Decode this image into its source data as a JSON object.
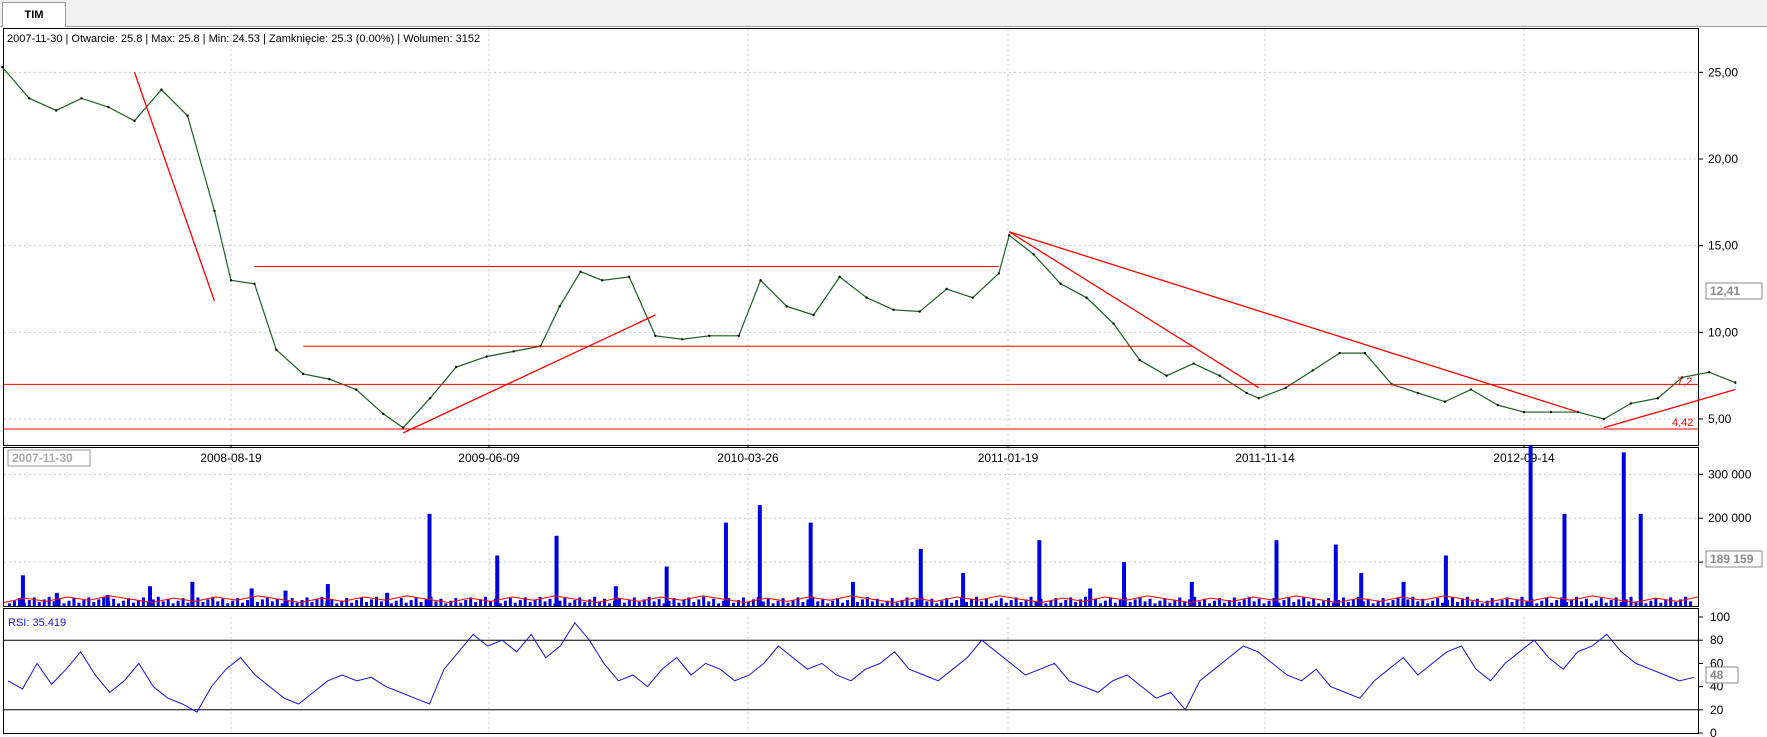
{
  "tab": {
    "label": "TIM"
  },
  "info_line": "2007-11-30 | Otwarcie: 25.8 | Max: 25.8 | Min: 24.53 | Zamknięcie: 25.3 (0.00%) | Wolumen: 3152",
  "cursor_date_label": "2007-11-30",
  "colors": {
    "price_line": "#1b5e20",
    "trend_lines": "#ff0000",
    "volume_bars": "#0000e0",
    "volume_avg": "#ff0000",
    "rsi_line": "#1515d6",
    "grid": "#c8c8c8"
  },
  "chart_data": [
    {
      "type": "line",
      "name": "price",
      "x_tick_labels": [
        "2008-08-19",
        "2009-06-09",
        "2010-03-26",
        "2011-01-19",
        "2011-11-14",
        "2012-09-14"
      ],
      "y_tick_labels": [
        "25,00",
        "20,00",
        "15,00",
        "10,00",
        "5,00"
      ],
      "ylim": [
        3.5,
        27.5
      ],
      "grid": true,
      "current_value_label": "12,41",
      "price_labels": [
        "7,2",
        "4,42"
      ],
      "x": [
        "2007-11-30",
        "2007-12-31",
        "2008-01-31",
        "2008-02-29",
        "2008-03-31",
        "2008-04-30",
        "2008-05-31",
        "2008-06-30",
        "2008-07-31",
        "2008-08-19",
        "2008-09-15",
        "2008-10-10",
        "2008-11-10",
        "2008-12-10",
        "2009-01-10",
        "2009-02-10",
        "2009-03-05",
        "2009-04-05",
        "2009-05-05",
        "2009-06-09",
        "2009-07-10",
        "2009-08-10",
        "2009-09-01",
        "2009-09-25",
        "2009-10-20",
        "2009-11-20",
        "2009-12-20",
        "2010-01-20",
        "2010-02-20",
        "2010-03-26",
        "2010-04-20",
        "2010-05-20",
        "2010-06-20",
        "2010-07-20",
        "2010-08-20",
        "2010-09-20",
        "2010-10-20",
        "2010-11-20",
        "2010-12-20",
        "2011-01-19",
        "2011-01-31",
        "2011-02-28",
        "2011-03-31",
        "2011-04-30",
        "2011-05-31",
        "2011-06-30",
        "2011-07-31",
        "2011-08-31",
        "2011-09-30",
        "2011-10-31",
        "2011-11-14",
        "2011-12-15",
        "2012-01-15",
        "2012-02-15",
        "2012-03-15",
        "2012-04-15",
        "2012-05-15",
        "2012-06-15",
        "2012-07-15",
        "2012-08-15",
        "2012-09-14",
        "2012-10-15",
        "2012-11-15",
        "2012-12-15",
        "2013-01-15",
        "2013-02-15",
        "2013-03-15",
        "2013-04-15",
        "2013-05-15"
      ],
      "values": [
        25.3,
        23.5,
        22.8,
        23.5,
        23.0,
        22.2,
        24.0,
        22.5,
        17.0,
        13.0,
        12.8,
        9.0,
        7.6,
        7.3,
        6.7,
        5.3,
        4.5,
        6.2,
        8.0,
        8.6,
        8.9,
        9.2,
        11.5,
        13.5,
        13.0,
        13.2,
        9.8,
        9.6,
        9.8,
        9.8,
        13.0,
        11.5,
        11.0,
        13.2,
        12.0,
        11.3,
        11.2,
        12.5,
        12.0,
        13.4,
        15.6,
        14.5,
        12.8,
        12.0,
        10.5,
        8.4,
        7.5,
        8.2,
        7.5,
        6.5,
        6.2,
        6.8,
        7.8,
        8.8,
        8.8,
        7.0,
        6.5,
        6.0,
        6.7,
        5.8,
        5.4,
        5.4,
        5.4,
        5.0,
        5.9,
        6.2,
        7.4,
        7.7,
        7.1
      ]
    },
    {
      "type": "bar",
      "name": "volume",
      "y_tick_labels": [
        "300 000",
        "200 000",
        "100 000"
      ],
      "ylim": [
        0,
        360000
      ],
      "current_value_label": "189 159",
      "x": [
        0.01,
        0.03,
        0.06,
        0.085,
        0.11,
        0.145,
        0.165,
        0.19,
        0.225,
        0.25,
        0.29,
        0.325,
        0.36,
        0.39,
        0.425,
        0.445,
        0.475,
        0.5,
        0.54,
        0.565,
        0.61,
        0.64,
        0.66,
        0.7,
        0.75,
        0.785,
        0.8,
        0.825,
        0.85,
        0.9,
        0.92,
        0.955,
        0.965
      ],
      "values": [
        70000,
        30000,
        25000,
        45000,
        55000,
        40000,
        35000,
        50000,
        30000,
        210000,
        115000,
        160000,
        45000,
        90000,
        190000,
        230000,
        190000,
        55000,
        130000,
        75000,
        150000,
        40000,
        100000,
        55000,
        150000,
        140000,
        75000,
        55000,
        115000,
        365000,
        210000,
        350000,
        210000
      ]
    },
    {
      "type": "line",
      "name": "RSI",
      "title": "RSI: 35.419",
      "y_tick_labels": [
        "100",
        "80",
        "60",
        "40",
        "20",
        "0"
      ],
      "ylim": [
        0,
        100
      ],
      "current_value_label": "48",
      "levels": [
        80,
        20
      ],
      "values": [
        45,
        38,
        60,
        42,
        55,
        70,
        50,
        35,
        45,
        60,
        40,
        30,
        25,
        18,
        40,
        55,
        65,
        50,
        40,
        30,
        25,
        35,
        45,
        50,
        45,
        48,
        40,
        35,
        30,
        25,
        55,
        70,
        85,
        75,
        80,
        70,
        85,
        65,
        75,
        95,
        80,
        60,
        45,
        50,
        40,
        55,
        65,
        50,
        60,
        55,
        45,
        50,
        60,
        75,
        65,
        55,
        60,
        50,
        45,
        55,
        60,
        70,
        55,
        50,
        45,
        55,
        65,
        80,
        70,
        60,
        50,
        55,
        60,
        45,
        40,
        35,
        45,
        50,
        40,
        30,
        35,
        20,
        45,
        55,
        65,
        75,
        70,
        60,
        50,
        45,
        55,
        40,
        35,
        30,
        45,
        55,
        65,
        50,
        60,
        70,
        75,
        55,
        45,
        60,
        70,
        80,
        65,
        55,
        70,
        75,
        85,
        70,
        60,
        55,
        50,
        45,
        48
      ]
    }
  ]
}
